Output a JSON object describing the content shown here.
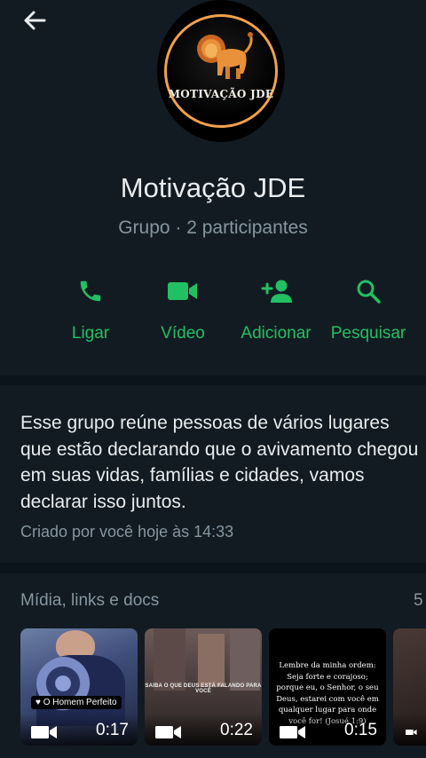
{
  "header": {
    "back_icon": "arrow-left-icon",
    "avatar_text": "MOTIVAÇÃO JDE",
    "group_name": "Motivação JDE",
    "group_subtitle": "Grupo · 2 participantes"
  },
  "actions": [
    {
      "label": "Ligar",
      "icon": "phone-icon"
    },
    {
      "label": "Vídeo",
      "icon": "video-camera-icon"
    },
    {
      "label": "Adicionar",
      "icon": "add-person-icon"
    },
    {
      "label": "Pesquisar",
      "icon": "search-icon"
    }
  ],
  "description": {
    "text": "Esse grupo reúne pessoas de vários lugares que estão declarando que o avivamento chegou em suas vidas, famílias e cidades, vamos declarar isso juntos.",
    "created": "Criado por você hoje às 14:33"
  },
  "media": {
    "title": "Mídia, links e docs",
    "count": "5",
    "items": [
      {
        "duration": "0:17",
        "caption": "♥ O Homem Perfeito"
      },
      {
        "duration": "0:22",
        "overlay": "SAIBA O QUE DEUS ESTÁ FALANDO PARA VOCÊ"
      },
      {
        "duration": "0:15",
        "quote": "Lembre da minha ordem: Seja forte e corajoso; porque eu, o Senhor, o seu Deus, estarei com você em qualquer lugar para onde você for! (Josué 1:9)"
      }
    ]
  },
  "colors": {
    "accent": "#21c063",
    "background": "#0b141a",
    "section": "#121b22",
    "secondary_text": "#8696a0"
  }
}
